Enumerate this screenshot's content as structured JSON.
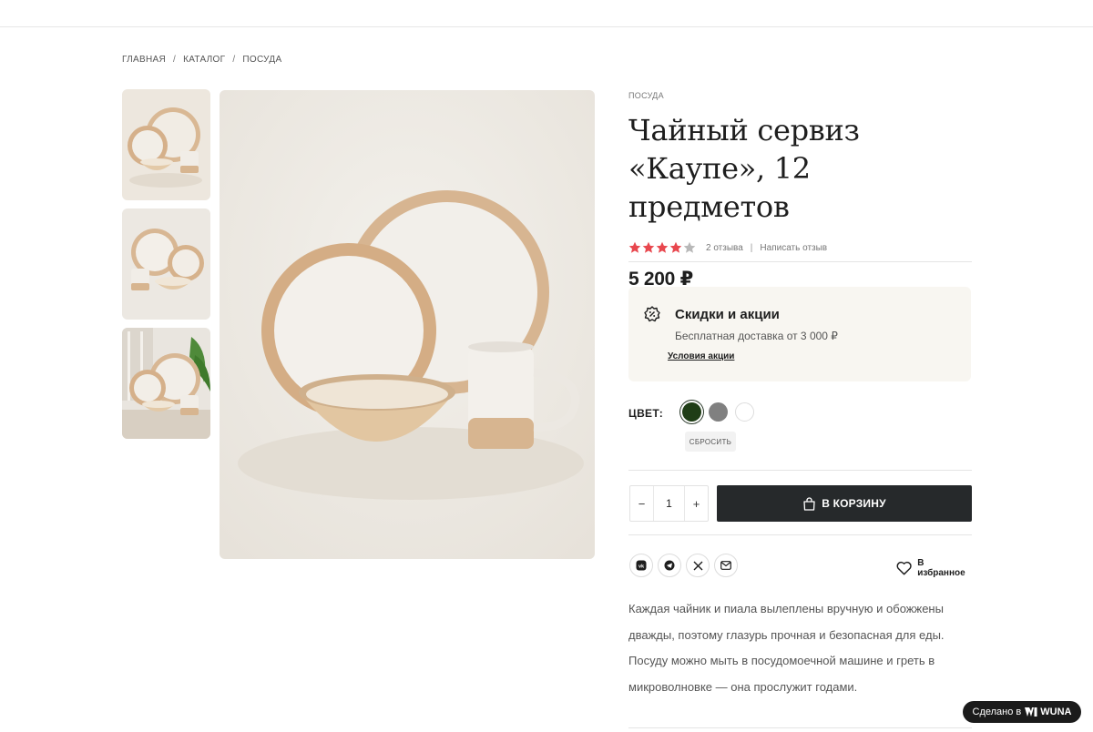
{
  "breadcrumb": {
    "home": "ГЛАВНАЯ",
    "catalog": "КАТАЛОГ",
    "current": "ПОСУДА",
    "separator": "/"
  },
  "product": {
    "category": "ПОСУДА",
    "title_line1": "Чайный сервиз",
    "title_line2": "«Каупе», 12 предметов",
    "rating": 4,
    "rating_max": 5,
    "reviews_label": "2 отзыва",
    "rating_divider": "|",
    "write_review_label": "Написать отзыв",
    "price": "5 200 ₽",
    "description": "Каждая чайник и пиала вылеплены вручную и обожжены дважды, поэтому глазурь прочная и безопасная для еды. Посуду можно мыть в посудомоечной машине и греть в микроволновке — она прослужит годами."
  },
  "promo": {
    "icon": "discount-badge-icon",
    "title": "Скидки и акции",
    "text": "Бесплатная доставка от 3 000 ₽",
    "link_label": "Условия акции"
  },
  "color": {
    "label": "ЦВЕТ:",
    "options": [
      {
        "name": "dark-green",
        "hex": "#1f3d16",
        "selected": true
      },
      {
        "name": "gray",
        "hex": "#808080",
        "selected": false
      },
      {
        "name": "white",
        "hex": "#ffffff",
        "selected": false
      }
    ],
    "reset_label": "СБРОСИТЬ"
  },
  "purchase": {
    "minus": "−",
    "plus": "+",
    "quantity": "1",
    "add_to_cart_label": "В КОРЗИНУ"
  },
  "share": {
    "icons": [
      "vk-icon",
      "telegram-icon",
      "x-icon",
      "mail-icon"
    ],
    "vk_label": "vk"
  },
  "favorites_label": "В избранное",
  "badge": {
    "prefix": "Сделано в",
    "brand": "WUNA"
  },
  "colors": {
    "accent_star": "#e8474e",
    "star_empty": "#b8b8b8",
    "cart_button": "#26292b",
    "promo_bg": "#f8f6f1"
  }
}
